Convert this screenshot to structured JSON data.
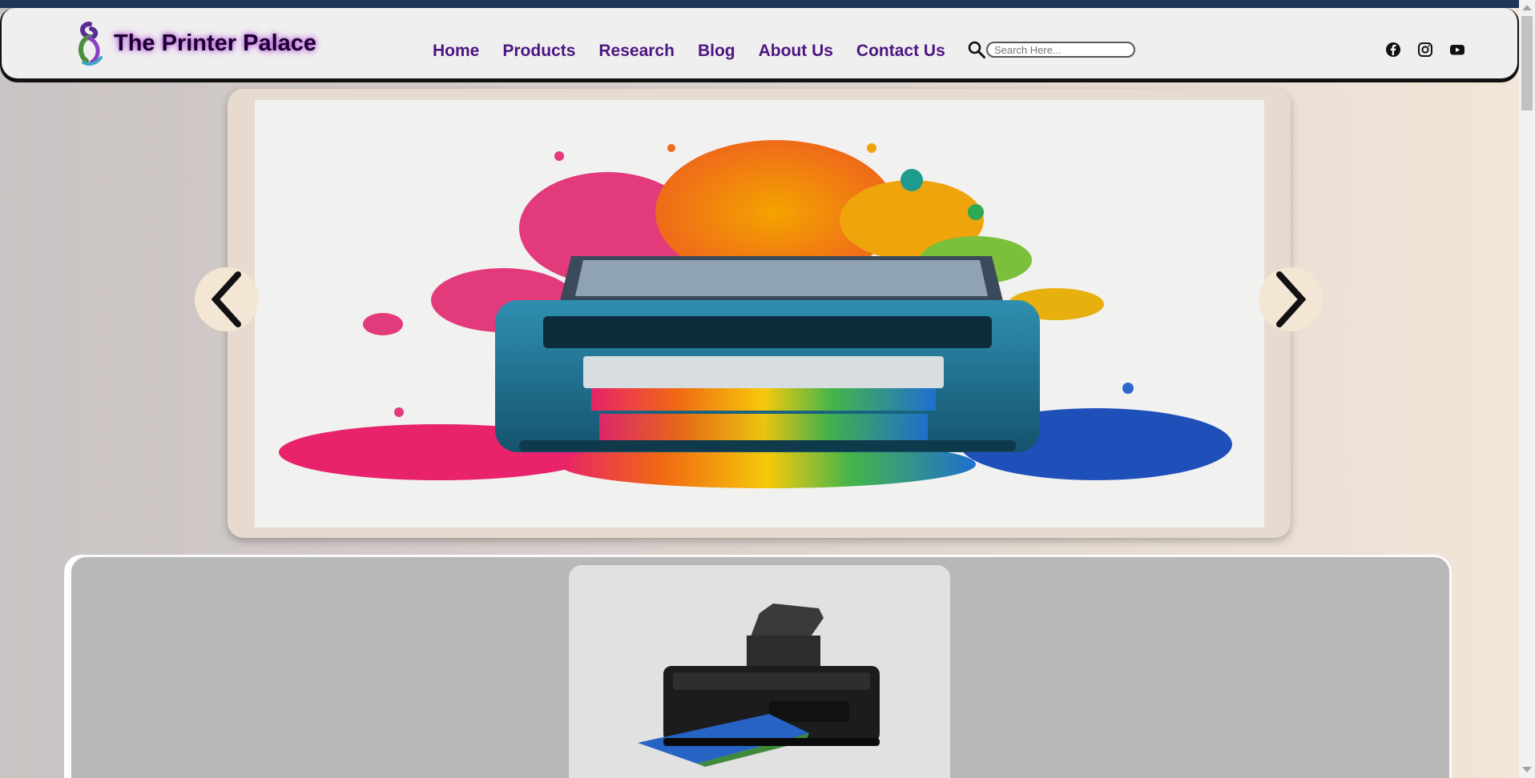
{
  "brand": {
    "name": "The Printer Palace"
  },
  "nav": {
    "items": [
      {
        "label": "Home"
      },
      {
        "label": "Products"
      },
      {
        "label": "Research"
      },
      {
        "label": "Blog"
      },
      {
        "label": "About Us"
      },
      {
        "label": "Contact Us"
      }
    ]
  },
  "search": {
    "placeholder": "Search Here...",
    "value": ""
  },
  "social": {
    "icons": [
      "facebook-icon",
      "instagram-icon",
      "youtube-icon"
    ]
  },
  "colors": {
    "nav_text": "#4b1582",
    "header_bg": "#efefef",
    "topbar": "#1f3558",
    "panel_bg": "#b8b8b8"
  }
}
